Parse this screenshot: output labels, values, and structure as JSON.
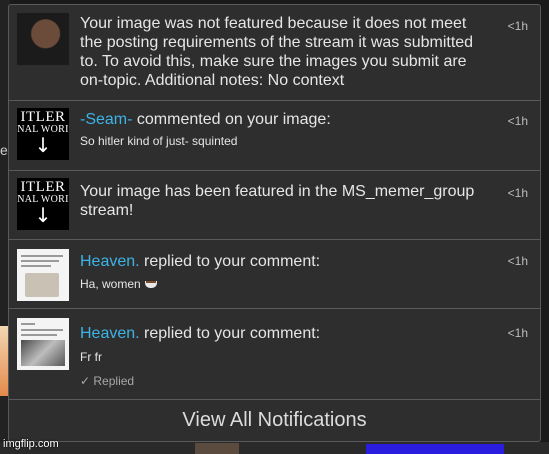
{
  "notifications": [
    {
      "message": "Your image was not featured because it does not meet the posting requirements of the stream it was submitted to. To avoid this, make sure the images you submit are on-topic. Additional notes: No context",
      "time": "<1h",
      "thumb_icon": "avatar-image"
    },
    {
      "username": "-Seam-",
      "action": " commented on your image:",
      "comment": "So hitler kind of just- squinted",
      "time": "<1h",
      "thumb_line1": "ITLER",
      "thumb_line2": "NAL WORI",
      "thumb_arrow": "↓"
    },
    {
      "message": "Your image has been featured in the MS_memer_group stream!",
      "time": "<1h",
      "thumb_line1": "ITLER",
      "thumb_line2": "NAL WORI",
      "thumb_arrow": "↓"
    },
    {
      "username": "Heaven.",
      "action": " replied to your comment:",
      "comment": "Ha, women",
      "time": "<1h",
      "thumb_icon": "meme-thumbnail"
    },
    {
      "username": "Heaven.",
      "action": " replied to your comment:",
      "comment": "Fr fr",
      "status": "✓ Replied",
      "time": "<1h",
      "thumb_icon": "meme-thumbnail"
    }
  ],
  "footer": {
    "label": "View All Notifications"
  },
  "watermark": "imgflip.com",
  "colors": {
    "username": "#3cb4e6",
    "panel": "#2e2e2f",
    "border": "#5a5a5c"
  }
}
